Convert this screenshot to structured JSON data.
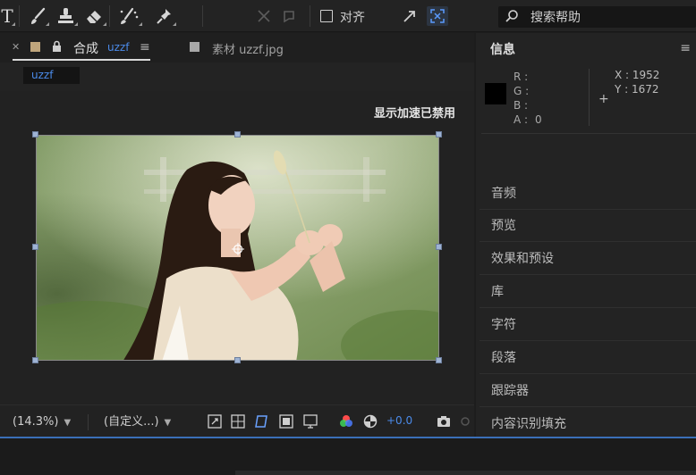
{
  "toolbar": {
    "text_tool": "T",
    "align_label": "对齐",
    "search_placeholder": "搜索帮助"
  },
  "composition_panel": {
    "tab_label": "合成",
    "tab_comp_name": "uzzf",
    "footage_tab": "素材 uzzf.jpg",
    "subtab": "uzzf",
    "gpu_notice": "显示加速已禁用"
  },
  "viewer_bar": {
    "zoom": "(14.3%)",
    "resolution": "(自定义...)",
    "exposure": "+0.0"
  },
  "info_panel": {
    "title": "信息",
    "r_label": "R :",
    "g_label": "G :",
    "b_label": "B :",
    "a_label": "A :",
    "a_value": "0",
    "x_label": "X : 1952",
    "y_label": "Y : 1672",
    "items": [
      "音频",
      "预览",
      "效果和预设",
      "库",
      "字符",
      "段落",
      "跟踪器",
      "内容识别填充"
    ]
  },
  "colors": {
    "accent": "#4b8bea",
    "panel": "#232323",
    "tab_bar": "#1f1f1f"
  }
}
